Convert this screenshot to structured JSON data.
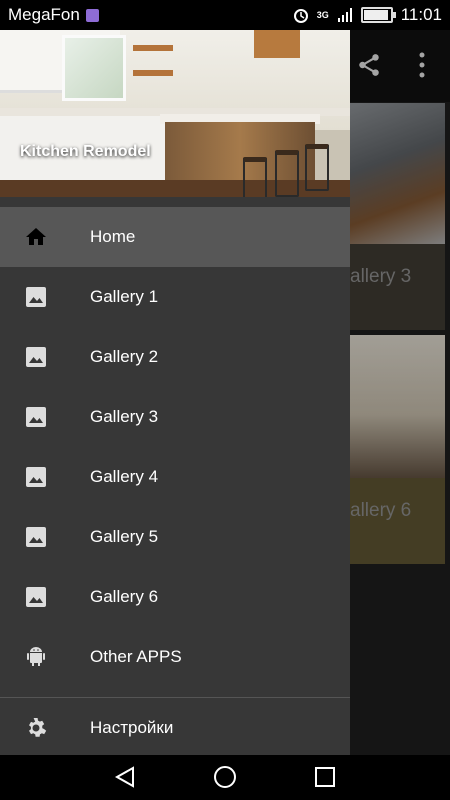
{
  "status_bar": {
    "carrier": "MegaFon",
    "network": "3G",
    "time": "11:01",
    "battery_level": 0.85
  },
  "drawer": {
    "header_title": "Kitchen Remodel",
    "items": [
      {
        "label": "Home",
        "icon": "home-icon",
        "active": true
      },
      {
        "label": "Gallery 1",
        "icon": "image-icon"
      },
      {
        "label": "Gallery 2",
        "icon": "image-icon"
      },
      {
        "label": "Gallery 3",
        "icon": "image-icon"
      },
      {
        "label": "Gallery 4",
        "icon": "image-icon"
      },
      {
        "label": "Gallery 5",
        "icon": "image-icon"
      },
      {
        "label": "Gallery 6",
        "icon": "image-icon"
      },
      {
        "label": "Other APPS",
        "icon": "android-icon"
      }
    ],
    "settings_label": "Настройки"
  },
  "background": {
    "cards": [
      {
        "caption": "allery 3"
      },
      {
        "caption": "allery 6"
      }
    ]
  },
  "colors": {
    "drawer_bg": "#373737",
    "active_item_bg": "#575757",
    "card3_caption_bg": "#3d3931",
    "card6_caption_bg": "#5b5231"
  }
}
